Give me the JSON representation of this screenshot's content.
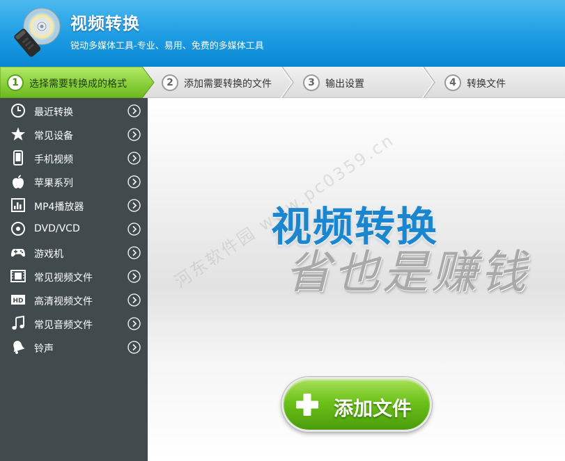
{
  "app": {
    "title": "视频转换",
    "subtitle": "锐动多媒体工具-专业、易用、免费的多媒体工具"
  },
  "steps": [
    {
      "number": "1",
      "label": "选择需要转换成的格式",
      "active": true
    },
    {
      "number": "2",
      "label": "添加需要转换的文件",
      "active": false
    },
    {
      "number": "3",
      "label": "输出设置",
      "active": false
    },
    {
      "number": "4",
      "label": "转换文件",
      "active": false
    }
  ],
  "sidebar": {
    "items": [
      {
        "label": "最近转换",
        "icon": "clock-icon"
      },
      {
        "label": "常见设备",
        "icon": "star-icon"
      },
      {
        "label": "手机视频",
        "icon": "phone-icon"
      },
      {
        "label": "苹果系列",
        "icon": "apple-icon"
      },
      {
        "label": "MP4播放器",
        "icon": "mp4-player-icon"
      },
      {
        "label": "DVD/VCD",
        "icon": "disc-icon"
      },
      {
        "label": "游戏机",
        "icon": "gamepad-icon"
      },
      {
        "label": "常见视频文件",
        "icon": "film-icon"
      },
      {
        "label": "高清视频文件",
        "icon": "hd-icon"
      },
      {
        "label": "常见音频文件",
        "icon": "music-note-icon"
      },
      {
        "label": "铃声",
        "icon": "bell-icon"
      }
    ]
  },
  "main": {
    "banner_title": "视频转换",
    "banner_slogan": "省也是赚钱",
    "watermark": "河东软件园 www.pc0359.cn",
    "add_button_label": "添加文件"
  },
  "colors": {
    "header_blue": "#1d9ce3",
    "sidebar_bg": "#414b4d",
    "active_step_green": "#6cc219",
    "banner_blue": "#1b86d0",
    "button_green": "#6cc219"
  }
}
